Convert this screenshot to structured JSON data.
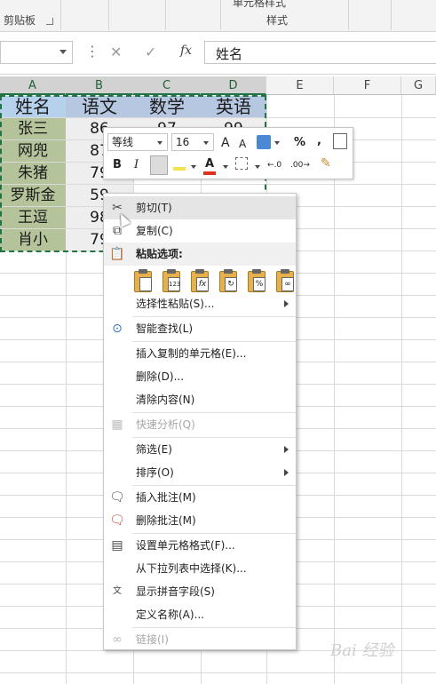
{
  "ribbon": {
    "group_clipboard": "剪贴板",
    "cell_styles": "单元格样式",
    "group_styles": "样式"
  },
  "formula_bar": {
    "cancel_icon": "✕",
    "enter_icon": "✓",
    "fx_label": "fx",
    "value": "姓名"
  },
  "columns": [
    "A",
    "B",
    "C",
    "D",
    "E",
    "F",
    "G"
  ],
  "table": {
    "headers": [
      "姓名",
      "语文",
      "数学",
      "英语"
    ],
    "rows": [
      [
        "张三",
        "86",
        "97",
        "99"
      ],
      [
        "网兜",
        "87",
        "",
        ""
      ],
      [
        "朱猪",
        "79",
        "",
        ""
      ],
      [
        "罗斯金",
        "59",
        "",
        ""
      ],
      [
        "王逗",
        "98",
        "",
        ""
      ],
      [
        "肖小",
        "79",
        "",
        ""
      ]
    ]
  },
  "mini_toolbar": {
    "font": "等线",
    "size": "16",
    "grow": "A",
    "shrink": "A",
    "percent": "%",
    "comma": ",",
    "bold": "B",
    "italic": "I",
    "font_color_letter": "A",
    "inc_decimal": "←.0",
    "dec_decimal": ".00→"
  },
  "context_menu": {
    "cut": "剪切(T)",
    "copy": "复制(C)",
    "paste_options": "粘贴选项:",
    "paste_special": "选择性粘贴(S)...",
    "smart_lookup": "智能查找(L)",
    "insert_copied": "插入复制的单元格(E)...",
    "delete": "删除(D)...",
    "clear": "清除内容(N)",
    "quick_analysis": "快速分析(Q)",
    "filter": "筛选(E)",
    "sort": "排序(O)",
    "insert_comment": "插入批注(M)",
    "delete_comment": "删除批注(M)",
    "format_cells": "设置单元格格式(F)...",
    "pick_list": "从下拉列表中选择(K)...",
    "phonetic": "显示拼音字段(S)",
    "define_name": "定义名称(A)...",
    "link": "链接(I)",
    "paste_icons": [
      "",
      "123",
      "fx",
      "↻",
      "%",
      "∞"
    ]
  },
  "watermark": "Bai 经验"
}
